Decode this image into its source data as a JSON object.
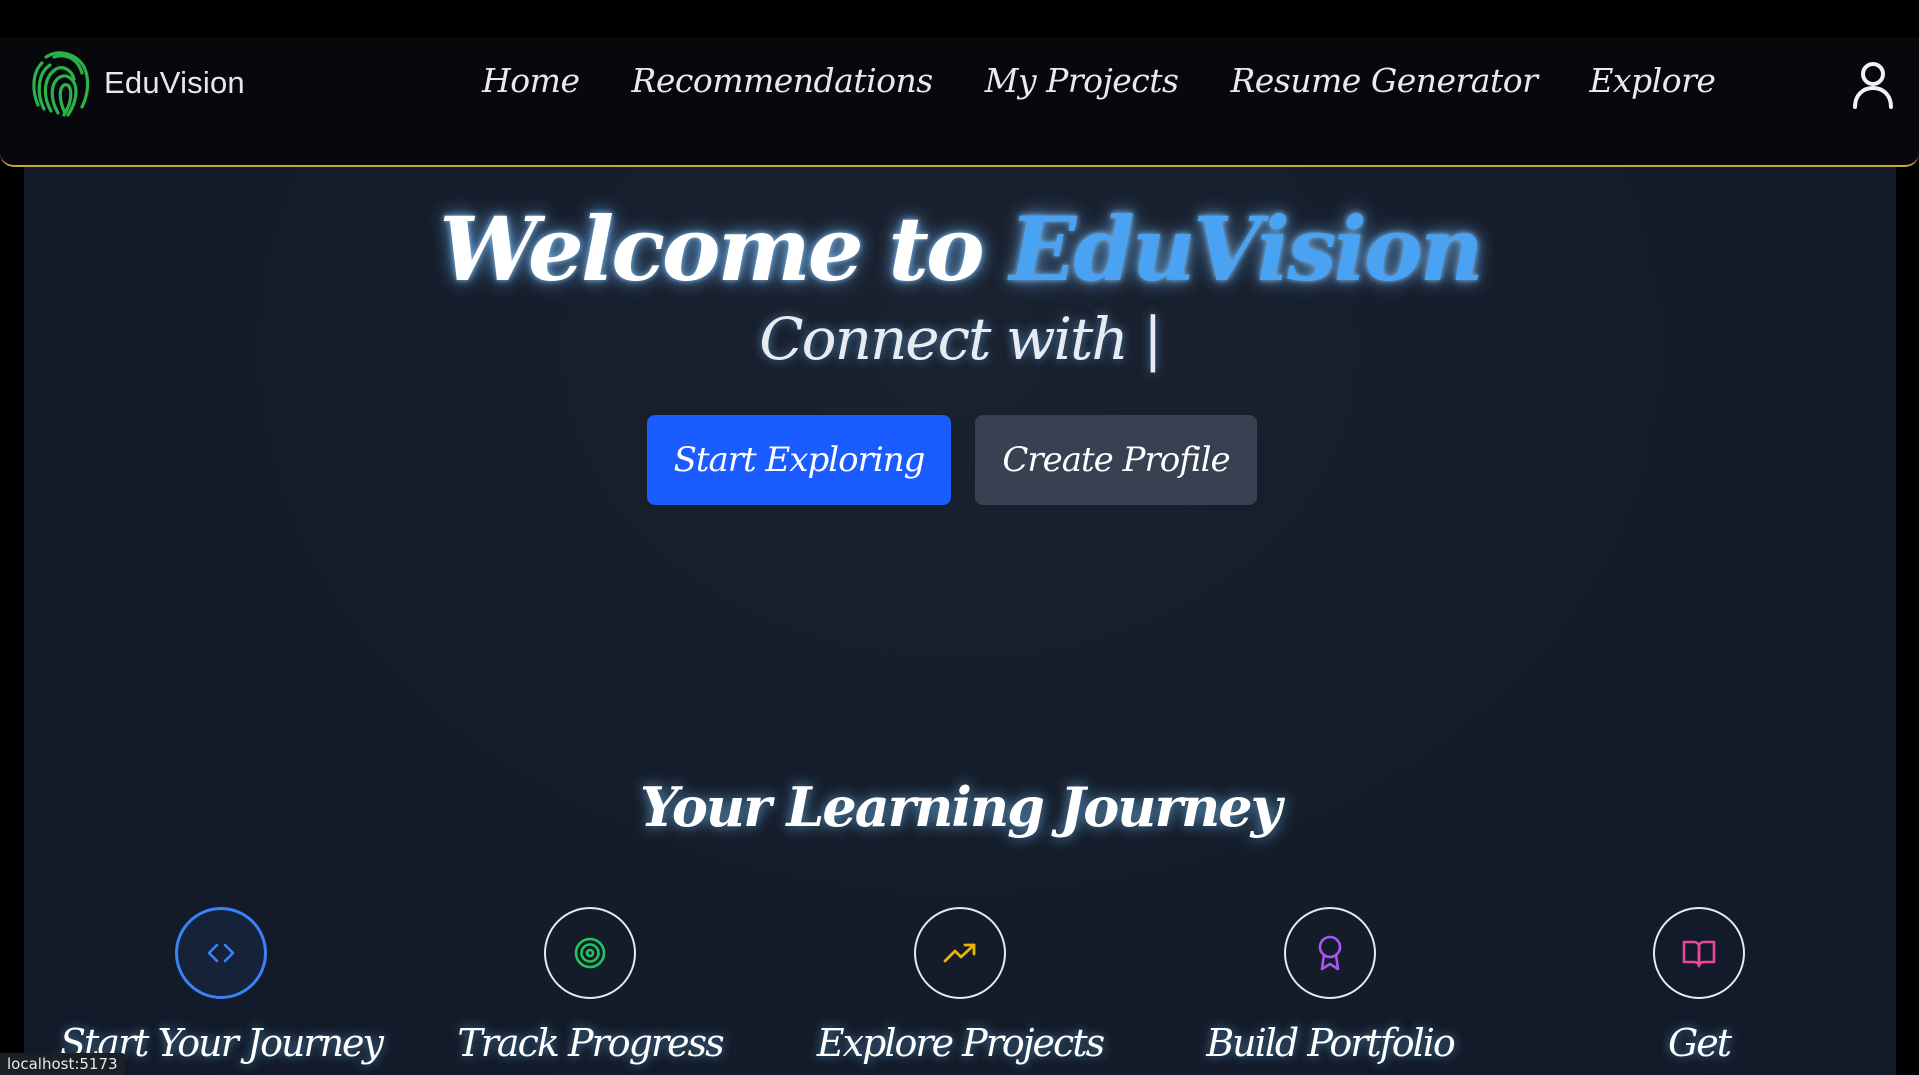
{
  "brand": {
    "name": "EduVision",
    "logo_icon": "fingerprint-icon"
  },
  "nav": {
    "items": [
      {
        "label": "Home"
      },
      {
        "label": "Recommendations"
      },
      {
        "label": "My Projects"
      },
      {
        "label": "Resume Generator"
      },
      {
        "label": "Explore"
      }
    ],
    "user_icon": "user-icon"
  },
  "hero": {
    "title_prefix": "Welcome to ",
    "title_accent": "EduVision",
    "subtitle": "Connect with |"
  },
  "cta": {
    "primary_label": "Start Exploring",
    "secondary_label": "Create Profile"
  },
  "journey": {
    "title": "Your Learning Journey",
    "steps": [
      {
        "label": "Start Your Journey",
        "icon": "code-icon",
        "color": "#3b82f6"
      },
      {
        "label": "Track Progress",
        "icon": "target-icon",
        "color": "#22c55e"
      },
      {
        "label": "Explore Projects",
        "icon": "trending-up-icon",
        "color": "#eab308"
      },
      {
        "label": "Build Portfolio",
        "icon": "award-icon",
        "color": "#a855f7"
      },
      {
        "label": "Get",
        "icon": "book-open-icon",
        "color": "#ec4899"
      }
    ]
  },
  "status_bar": {
    "url": "localhost:5173"
  },
  "colors": {
    "accent": "#4aa3f2",
    "primary_button": "#1a5cff",
    "secondary_button": "#374151",
    "navbar_border": "#c9a640",
    "logo_green": "#2bb34a"
  }
}
